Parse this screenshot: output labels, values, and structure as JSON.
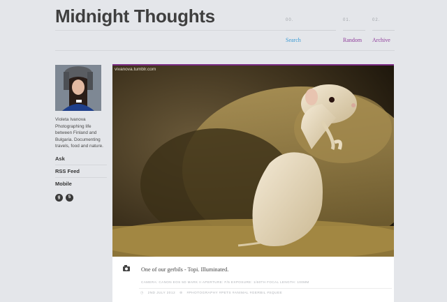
{
  "site": {
    "title": "Midnight Thoughts"
  },
  "nav": [
    {
      "num": "00.",
      "label": "Search",
      "color": "#3a9ad4"
    },
    {
      "num": "01.",
      "label": "Random",
      "color": "#8e3b9a"
    },
    {
      "num": "02.",
      "label": "Archive",
      "color": "#8e3b9a"
    }
  ],
  "sidebar": {
    "bio": "Violeta Ivanova Photographing life between Finland and Bulgaria. Documenting travels, food and nature.",
    "links": [
      "Ask",
      "RSS Feed",
      "Mobile"
    ],
    "social": [
      {
        "icon": "google-plus-icon",
        "glyph": "g"
      },
      {
        "icon": "500px-icon",
        "glyph": "5"
      }
    ]
  },
  "post": {
    "watermark": "vivanova.tumblr.com",
    "caption": "One of our gerbils - Topi. Illuminated.",
    "exif": "CAMERA: CANON EOS 5D MARK II    APERTURE: F/5    EXPOSURE: 1/60TH    FOCAL LENGTH: 100MM",
    "date": "2ND JULY 2012",
    "tags": "#PHOTOGRAPHY #PETS #ANIMAL #GERBIL #SQUEE"
  },
  "colors": {
    "accent": "#7a2a83",
    "link": "#3a9ad4"
  }
}
